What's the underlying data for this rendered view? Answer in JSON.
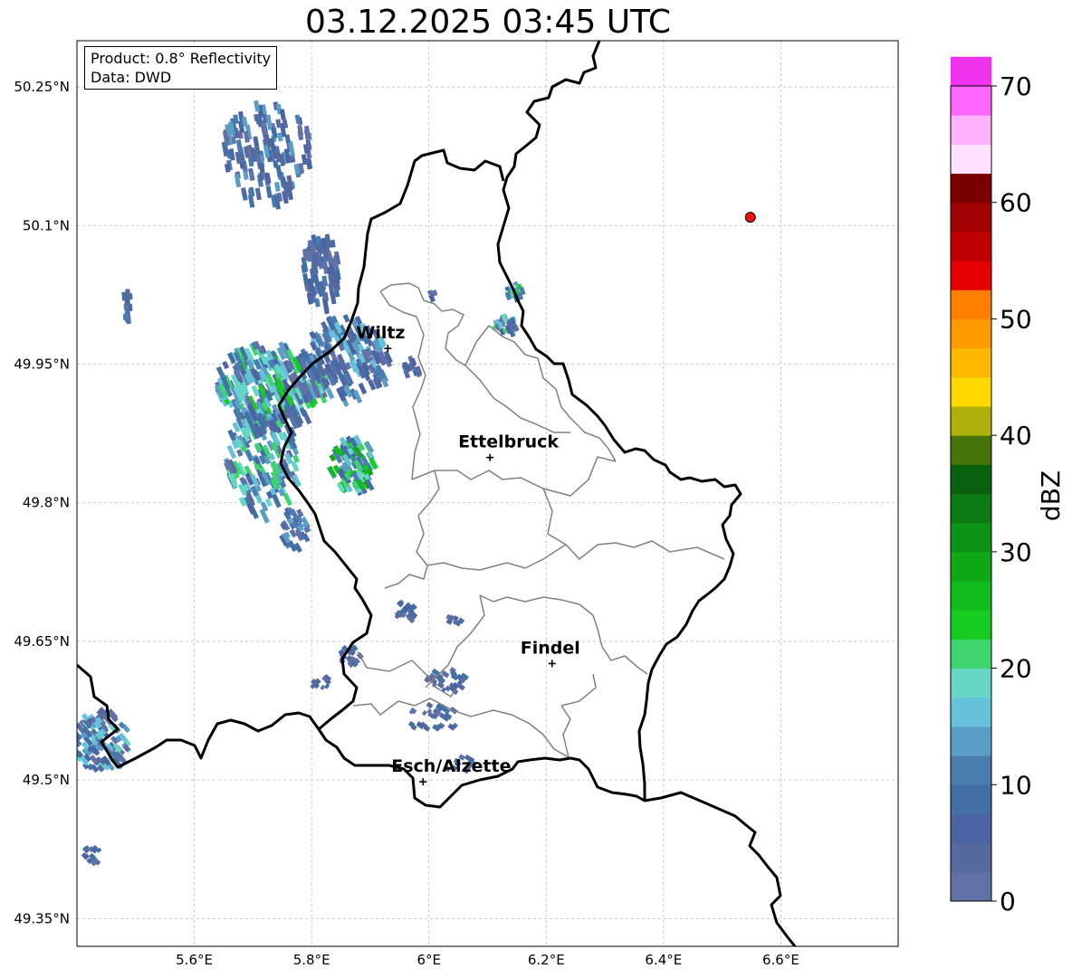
{
  "title": "03.12.2025 03:45 UTC",
  "info": {
    "product": "Product: 0.8° Reflectivity",
    "source": "Data: DWD"
  },
  "map": {
    "lon_range": [
      5.4,
      6.8
    ],
    "lat_range": [
      49.32,
      50.3
    ],
    "x_ticks": [
      {
        "value": 5.6,
        "label": "5.6°E"
      },
      {
        "value": 5.8,
        "label": "5.8°E"
      },
      {
        "value": 6.0,
        "label": "6°E"
      },
      {
        "value": 6.2,
        "label": "6.2°E"
      },
      {
        "value": 6.4,
        "label": "6.4°E"
      },
      {
        "value": 6.6,
        "label": "6.6°E"
      }
    ],
    "y_ticks": [
      {
        "value": 49.35,
        "label": "49.35°N"
      },
      {
        "value": 49.5,
        "label": "49.5°N"
      },
      {
        "value": 49.65,
        "label": "49.65°N"
      },
      {
        "value": 49.8,
        "label": "49.8°N"
      },
      {
        "value": 49.95,
        "label": "49.95°N"
      },
      {
        "value": 50.1,
        "label": "50.1°N"
      },
      {
        "value": 50.25,
        "label": "50.25°N"
      }
    ],
    "cities": [
      {
        "name": "Wiltz",
        "lon": 5.93,
        "lat": 49.967
      },
      {
        "name": "Ettelbruck",
        "lon": 6.104,
        "lat": 49.849
      },
      {
        "name": "Findel",
        "lon": 6.21,
        "lat": 49.626
      },
      {
        "name": "Esch/Alzette",
        "lon": 5.99,
        "lat": 49.498
      }
    ],
    "radar_site": {
      "lon": 6.548,
      "lat": 50.109,
      "color": "#ee1111"
    }
  },
  "colorbar": {
    "label": "dBZ",
    "min": 0,
    "max": 70,
    "step": 2.5,
    "ticks": [
      {
        "value": 0,
        "label": "0"
      },
      {
        "value": 10,
        "label": "10"
      },
      {
        "value": 20,
        "label": "20"
      },
      {
        "value": 30,
        "label": "30"
      },
      {
        "value": 40,
        "label": "40"
      },
      {
        "value": 50,
        "label": "50"
      },
      {
        "value": 60,
        "label": "60"
      },
      {
        "value": 70,
        "label": "70"
      }
    ],
    "colors": [
      "#6272a6",
      "#566aa0",
      "#4a64a4",
      "#4270a6",
      "#4a7cb0",
      "#5a9ec6",
      "#66c2da",
      "#66d6c6",
      "#3ed46e",
      "#16cc20",
      "#10bc1c",
      "#10a816",
      "#0e9414",
      "#0c7a12",
      "#0a6210",
      "#46740a",
      "#b0b00a",
      "#ffd800",
      "#ffb800",
      "#ff9a00",
      "#ff7e00",
      "#e40000",
      "#c00000",
      "#a00000",
      "#7a0000",
      "#ffe0ff",
      "#ffb0ff",
      "#ff66ff",
      "#ee33ee"
    ]
  }
}
